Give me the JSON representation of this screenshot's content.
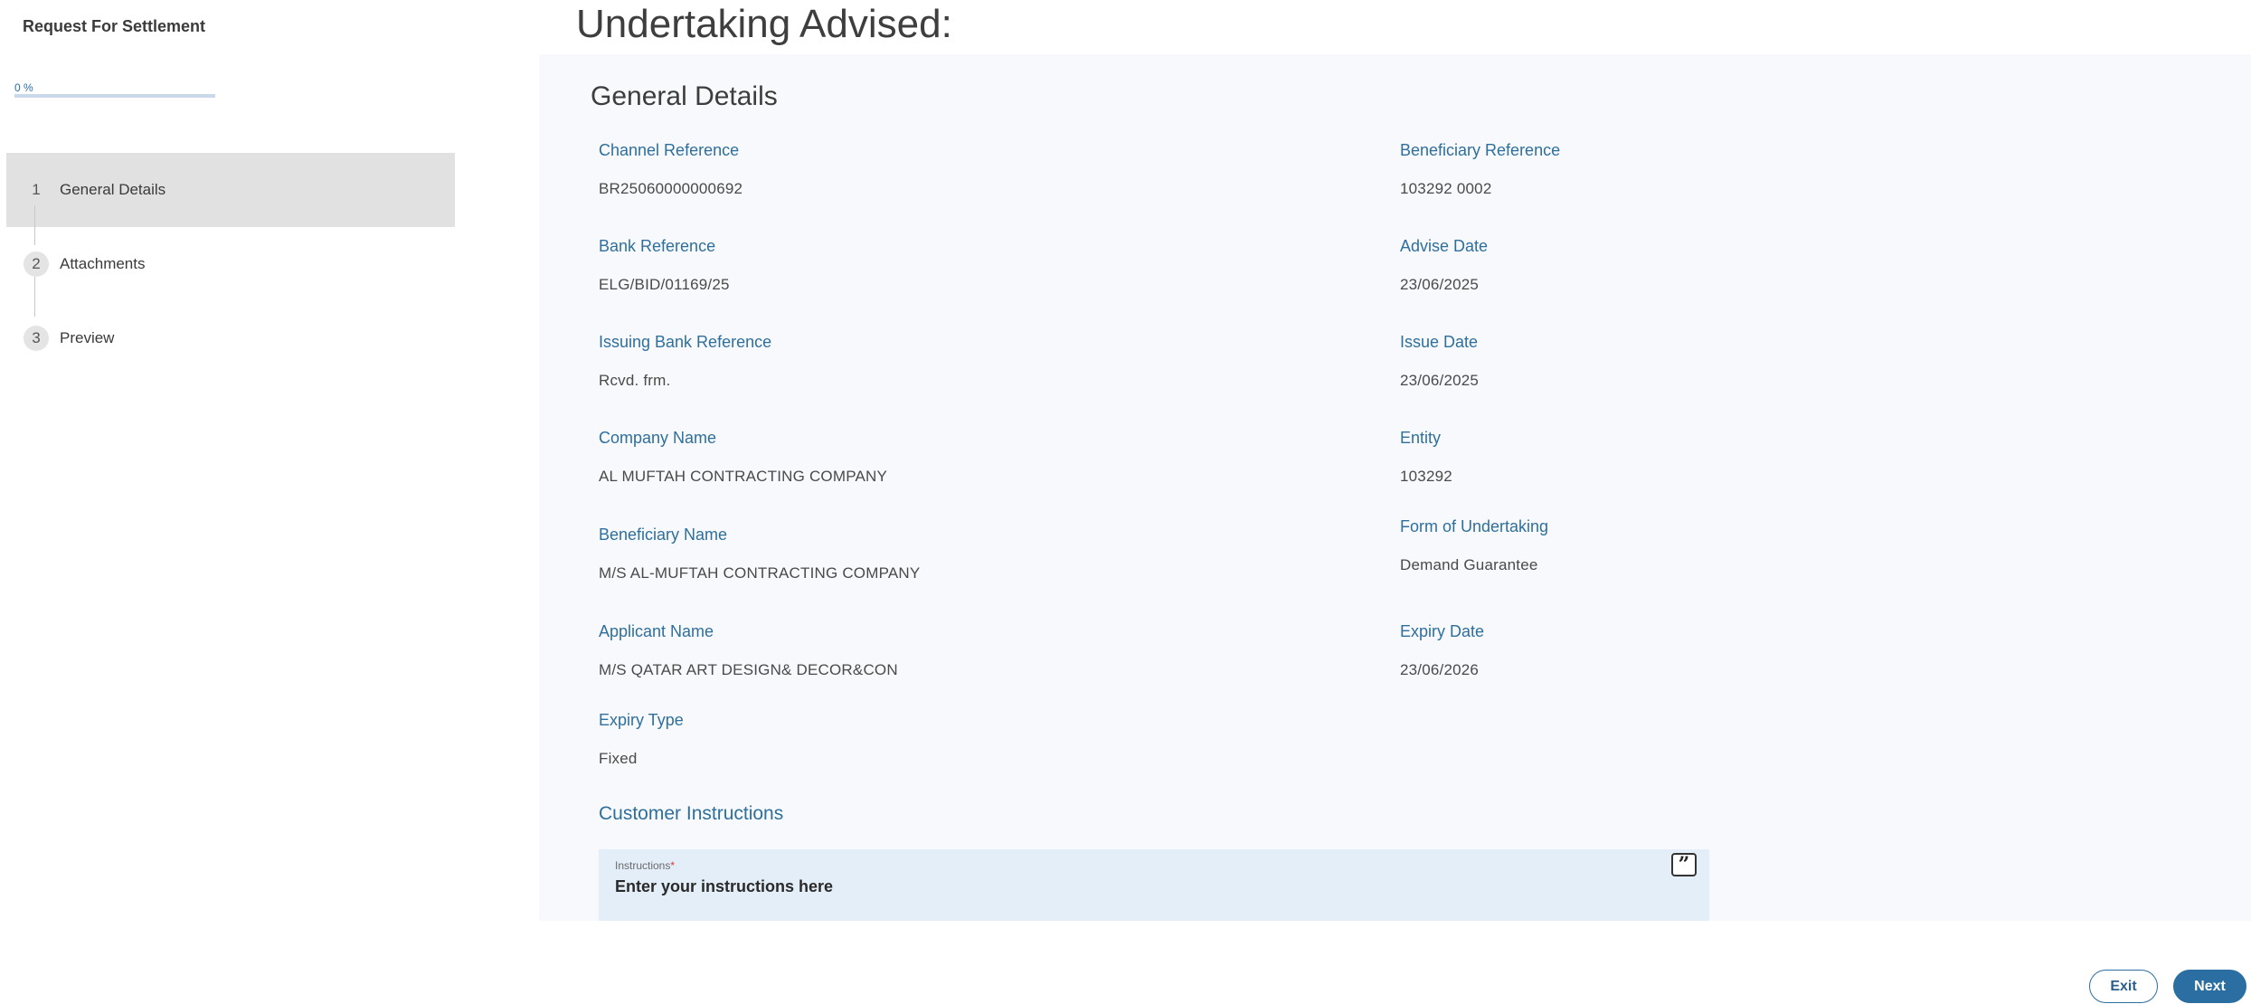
{
  "sidebar": {
    "title": "Request For Settlement",
    "progress": {
      "label": "0 %",
      "value": 0
    },
    "steps": [
      {
        "number": "1",
        "label": "General Details",
        "active": true
      },
      {
        "number": "2",
        "label": "Attachments",
        "active": false
      },
      {
        "number": "3",
        "label": "Preview",
        "active": false
      }
    ]
  },
  "main": {
    "title": "Undertaking Advised:",
    "section_title": "General Details",
    "fields": {
      "channel_reference": {
        "label": "Channel Reference",
        "value": "BR25060000000692"
      },
      "beneficiary_reference": {
        "label": "Beneficiary Reference",
        "value": "103292 0002"
      },
      "bank_reference": {
        "label": "Bank Reference",
        "value": "ELG/BID/01169/25"
      },
      "advise_date": {
        "label": "Advise Date",
        "value": "23/06/2025"
      },
      "issuing_bank_reference": {
        "label": "Issuing Bank Reference",
        "value": "Rcvd. frm."
      },
      "issue_date": {
        "label": "Issue Date",
        "value": "23/06/2025"
      },
      "company_name": {
        "label": "Company Name",
        "value": "AL MUFTAH CONTRACTING COMPANY"
      },
      "entity": {
        "label": "Entity",
        "value": "103292"
      },
      "beneficiary_name": {
        "label": "Beneficiary Name",
        "value": "M/S AL-MUFTAH CONTRACTING COMPANY"
      },
      "form_of_undertaking": {
        "label": "Form of Undertaking",
        "value": "Demand Guarantee"
      },
      "applicant_name": {
        "label": "Applicant Name",
        "value": "M/S QATAR ART DESIGN& DECOR&CON"
      },
      "expiry_date": {
        "label": "Expiry Date",
        "value": "23/06/2026"
      },
      "expiry_type": {
        "label": "Expiry Type",
        "value": "Fixed"
      }
    },
    "customer_instructions": {
      "heading": "Customer Instructions",
      "field_label": "Instructions",
      "required_mark": "*",
      "placeholder": "Enter your instructions here",
      "quote_icon": "quote-icon"
    }
  },
  "footer": {
    "exit_label": "Exit",
    "next_label": "Next"
  },
  "colors": {
    "accent": "#2b6ea1",
    "label_blue": "#2f6f9c",
    "panel_bg": "#f7f9fc",
    "input_bg": "#e3eef8",
    "active_step_bg": "#e1e1e1",
    "required": "#d43a3a"
  }
}
